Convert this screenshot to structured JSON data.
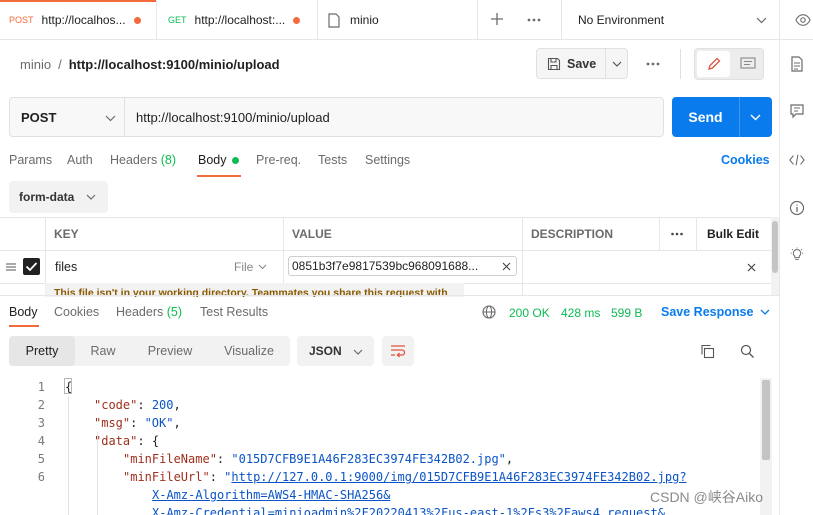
{
  "tabs": [
    {
      "method": "POST",
      "title": "http://localhos...",
      "method_color": "#f26b3a",
      "modified": true
    },
    {
      "method": "GET",
      "title": "http://localhost:...",
      "method_color": "#0cbb52",
      "modified": true
    },
    {
      "title": "minio",
      "modified": false
    }
  ],
  "environment": "No Environment",
  "breadcrumb": {
    "collection": "minio",
    "separator": "/",
    "request": "http://localhost:9100/minio/upload"
  },
  "save_label": "Save",
  "request": {
    "method": "POST",
    "url": "http://localhost:9100/minio/upload",
    "send_label": "Send"
  },
  "request_tabs": {
    "params": "Params",
    "auth": "Auth",
    "headers": "Headers",
    "headers_count": "(8)",
    "body": "Body",
    "prereq": "Pre-req.",
    "tests": "Tests",
    "settings": "Settings",
    "cookies": "Cookies"
  },
  "body_mode": "form-data",
  "table": {
    "headers": {
      "key": "KEY",
      "value": "VALUE",
      "description": "DESCRIPTION",
      "bulk": "Bulk Edit"
    },
    "row": {
      "key": "files",
      "type": "File",
      "value": "0851b3f7e9817539bc968091688...",
      "checked": true
    },
    "tooltip": "This file isn't in your working directory. Teammates you share this request with"
  },
  "response": {
    "tabs": {
      "body": "Body",
      "cookies": "Cookies",
      "headers": "Headers",
      "headers_count": "(5)",
      "tests": "Test Results"
    },
    "status": "200 OK",
    "time": "428 ms",
    "size": "599 B",
    "save_label": "Save Response",
    "views": [
      "Pretty",
      "Raw",
      "Preview",
      "Visualize"
    ],
    "active_view": "Pretty",
    "format": "JSON"
  },
  "code_lines": [
    {
      "n": "1"
    },
    {
      "n": "2"
    },
    {
      "n": "3"
    },
    {
      "n": "4"
    },
    {
      "n": "5"
    },
    {
      "n": "6"
    }
  ],
  "json": {
    "open_brace": "{",
    "code_key": "\"code\"",
    "code_val": "200",
    "msg_key": "\"msg\"",
    "msg_val": "\"OK\"",
    "data_key": "\"data\"",
    "data_open": "{",
    "name_key": "\"minFileName\"",
    "name_val": "\"015D7CFB9E1A46F283EC3974FE342B02.jpg\"",
    "url_key": "\"minFileUrl\"",
    "url_quote": "\"",
    "url_part1": "http://127.0.0.1:9000/img/015D7CFB9E1A46F283EC3974FE342B02.jpg?",
    "url_part2": "X-Amz-Algorithm=AWS4-HMAC-SHA256&",
    "url_part3": "X-Amz-Credential=minioadmin%2F20220413%2Fus-east-1%2Fs3%2Faws4_request&"
  },
  "watermark": "CSDN @峡谷Aiko"
}
